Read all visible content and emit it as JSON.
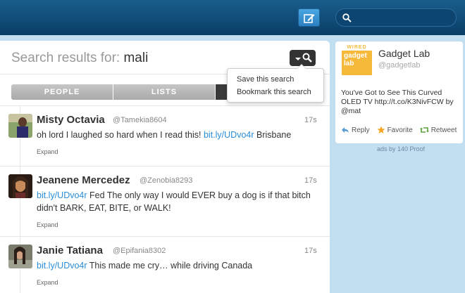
{
  "topbar": {
    "search_placeholder": ""
  },
  "search": {
    "prefix": "Search results for:",
    "query": "mali"
  },
  "tabs": [
    {
      "label": "PEOPLE"
    },
    {
      "label": "LISTS"
    },
    {
      "label": ""
    }
  ],
  "dropdown": {
    "items": [
      "Save this search",
      "Bookmark this search"
    ]
  },
  "tweets": [
    {
      "name": "Misty Octavia",
      "handle": "@Tamekia8604",
      "time": "17s",
      "text_before": "oh lord I laughed so hard when I read this!",
      "link": "bit.ly/UDvo4r",
      "text_after": "Brisbane",
      "expand": "Expand"
    },
    {
      "name": "Jeanene Mercedez",
      "handle": "@Zenobia8293",
      "time": "17s",
      "text_before": "",
      "link": "bit.ly/UDvo4r",
      "text_after": "Fed The only way I would EVER buy a dog is if that bitch didn't BARK, EAT, BITE, or WALK!",
      "expand": "Expand"
    },
    {
      "name": "Janie Tatiana",
      "handle": "@Epifania8302",
      "time": "17s",
      "text_before": "",
      "link": "bit.ly/UDvo4r",
      "text_after": "This made me cry… while driving Canada",
      "expand": "Expand"
    }
  ],
  "ad_card": {
    "name": "Gadget Lab",
    "handle": "@gadgetlab",
    "logo_top": "WIRED",
    "logo_text": "gadget lab",
    "text": "You've Got to See This Curved OLED TV http://t.co/K3NivFCW by @mat",
    "actions": [
      "Reply",
      "Favorite",
      "Retweet"
    ],
    "footer": "ads by 140 Proof"
  },
  "colors": {
    "topbar": "#0f4a78",
    "link": "#2a8ed9",
    "page_bg": "#c2dff2",
    "logo": "#f7b93a"
  }
}
